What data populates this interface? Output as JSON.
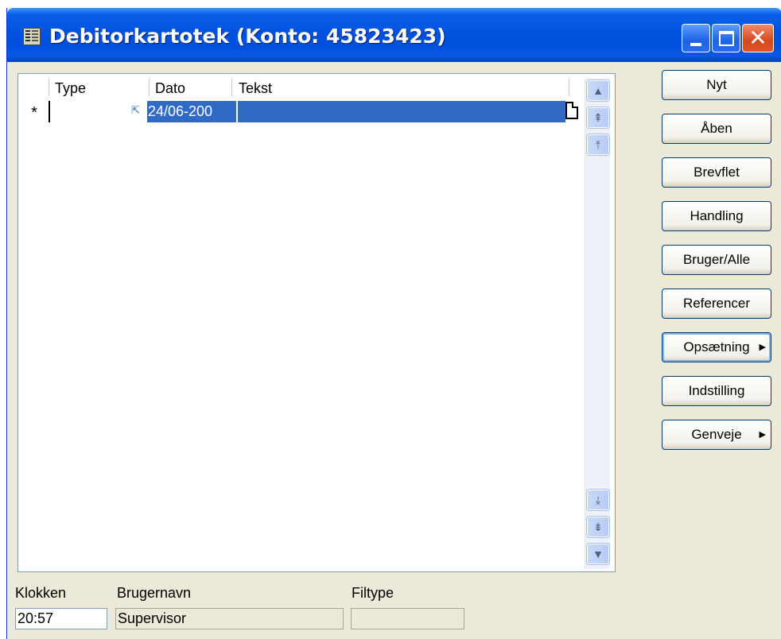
{
  "window": {
    "title": "Debitorkartotek (Konto: 45823423)",
    "controls": {
      "minimize": "",
      "maximize": "",
      "close": "✕"
    }
  },
  "grid": {
    "columns": {
      "type": "Type",
      "date": "Dato",
      "text": "Tekst"
    },
    "rows": [
      {
        "marker": "*",
        "type": "",
        "date": "24/06-200",
        "text": ""
      }
    ]
  },
  "buttons": [
    {
      "label": "Nyt",
      "accesskey": "y"
    },
    {
      "label": "Åben",
      "accesskey": "Å"
    },
    {
      "label": "Brevflet",
      "accesskey": "B"
    },
    {
      "label": "Handling",
      "accesskey": "a"
    },
    {
      "label": "Bruger/Alle",
      "accesskey": "g"
    },
    {
      "label": "Referencer",
      "accesskey": "f"
    },
    {
      "label": "Opsætning",
      "accesskey": "O",
      "submenu": true
    },
    {
      "label": "Indstilling",
      "accesskey": "t"
    },
    {
      "label": "Genveje",
      "accesskey": "e",
      "submenu": true
    }
  ],
  "status": {
    "clock_label": "Klokken",
    "clock_value": "20:57",
    "user_label": "Brugernavn",
    "user_value": "Supervisor",
    "filetype_label": "Filtype",
    "filetype_value": ""
  },
  "icons": {
    "window": "card-index-icon",
    "link": "link-arrow-icon",
    "document": "document-icon",
    "scroll": [
      "scroll-up-icon",
      "page-up-icon",
      "scroll-top-icon",
      "scroll-bottom-icon",
      "page-down-icon",
      "scroll-down-icon"
    ]
  },
  "colors": {
    "title_bar": "#0053e0",
    "selection": "#316ac5",
    "window_face": "#ece9d8",
    "close_button": "#d5481e"
  }
}
